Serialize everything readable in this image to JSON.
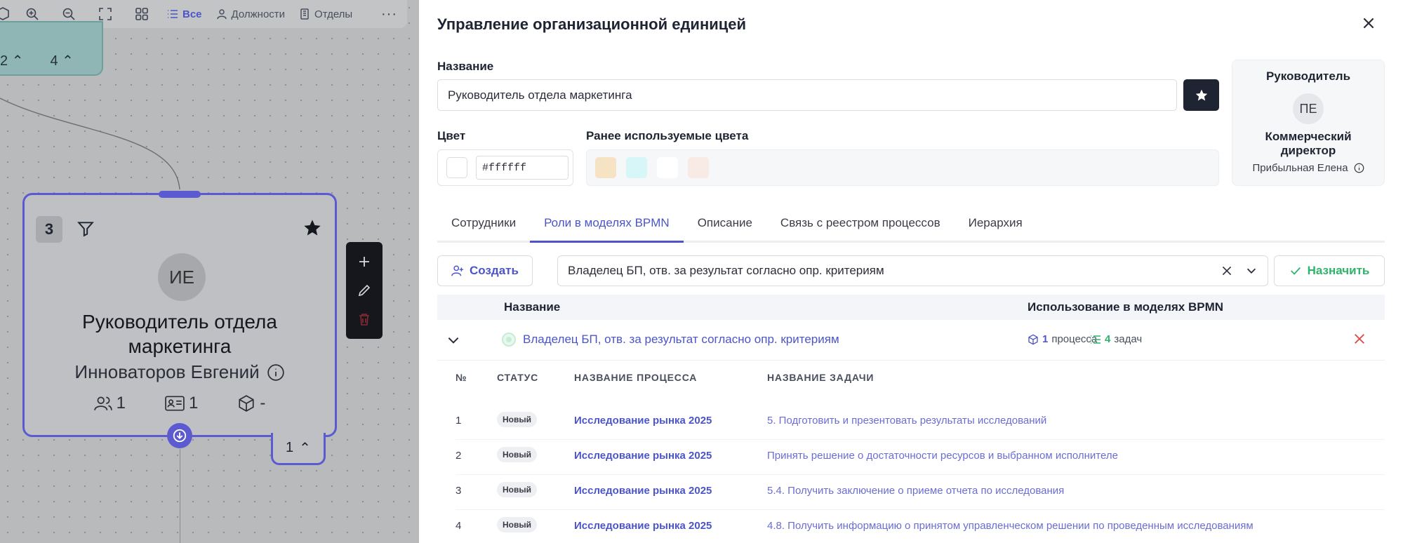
{
  "canvas": {
    "toolbar": {
      "filters": [
        {
          "label": "Все",
          "icon": "list-icon",
          "active": true
        },
        {
          "label": "Должности",
          "icon": "person-icon",
          "active": false
        },
        {
          "label": "Отделы",
          "icon": "building-icon",
          "active": false
        }
      ],
      "more": "···"
    },
    "teal_node": {
      "count_a": "2",
      "count_b": "4"
    },
    "card": {
      "number": "3",
      "initials": "ИЕ",
      "title_line1": "Руководитель отдела",
      "title_line2": "маркетинга",
      "person": "Инноваторов Евгений",
      "employees": "1",
      "positions": "1",
      "processes": "-",
      "bottom_count": "1"
    }
  },
  "panel": {
    "title": "Управление организационной единицей",
    "name_label": "Название",
    "name_value": "Руководитель отдела маркетинга",
    "color_label": "Цвет",
    "color_value": "#ffffff",
    "prev_colors_label": "Ранее используемые цвета",
    "prev_colors": [
      "#f6e3c4",
      "#d6f6f8",
      "#ffffff",
      "#f8ebe6"
    ],
    "head": {
      "label": "Руководитель",
      "initials": "ПЕ",
      "role": "Коммерческий директор",
      "person": "Прибыльная Елена"
    },
    "tabs": [
      "Сотрудники",
      "Роли в моделях BPMN",
      "Описание",
      "Связь с реестром процессов",
      "Иерархия"
    ],
    "active_tab": 1,
    "create_label": "Создать",
    "role_select_value": "Владелец БП, отв. за результат согласно опр. критериям",
    "assign_label": "Назначить",
    "table": {
      "col_name": "Название",
      "col_usage": "Использование в моделях BPMN",
      "role_name": "Владелец БП, отв. за результат согласно опр. критериям",
      "proc_count": "1",
      "proc_label": "процесса",
      "task_count": "4",
      "task_label": "задач"
    },
    "sub_table": {
      "col_num": "№",
      "col_status": "СТАТУС",
      "col_process": "НАЗВАНИЕ ПРОЦЕССА",
      "col_task": "НАЗВАНИЕ ЗАДАЧИ",
      "rows": [
        {
          "num": "1",
          "status": "Новый",
          "process": "Исследование рынка 2025",
          "task": "5. Подготовить и презентовать результаты исследований"
        },
        {
          "num": "2",
          "status": "Новый",
          "process": "Исследование рынка 2025",
          "task": "Принять решение о достаточности ресурсов и выбранном исполнителе"
        },
        {
          "num": "3",
          "status": "Новый",
          "process": "Исследование рынка 2025",
          "task": "5.4. Получить заключение о приеме отчета по исследования"
        },
        {
          "num": "4",
          "status": "Новый",
          "process": "Исследование рынка 2025",
          "task": "4.8. Получить информацию о принятом управленческом решении по проведенным исследованиям"
        }
      ]
    }
  }
}
